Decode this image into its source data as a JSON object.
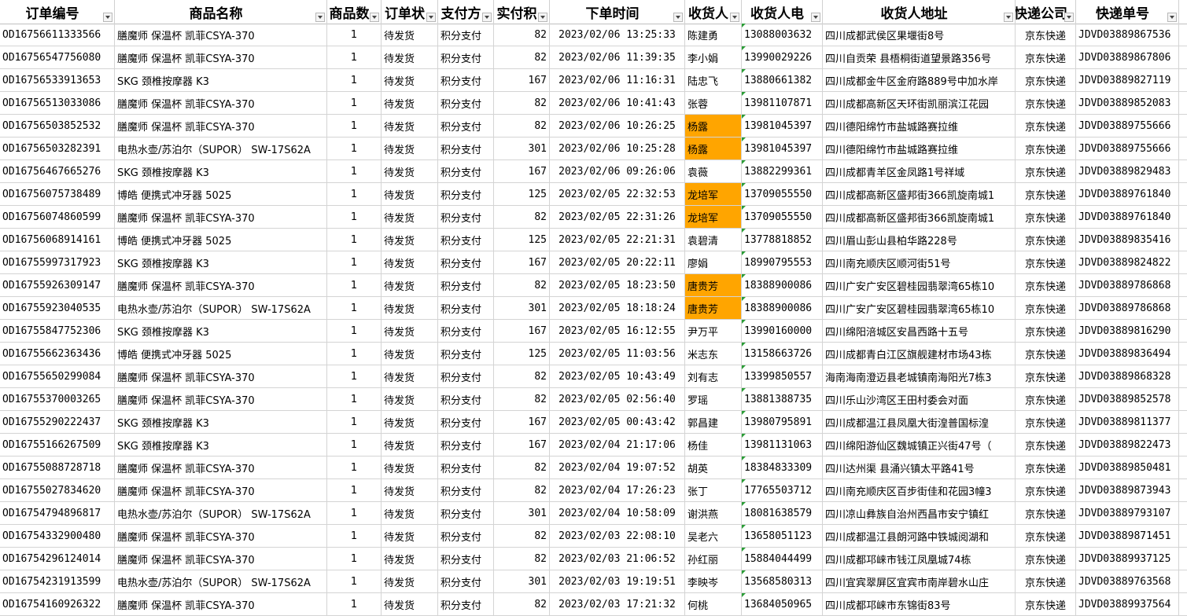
{
  "columns": [
    {
      "key": "id",
      "label": "订单编号"
    },
    {
      "key": "product",
      "label": "商品名称"
    },
    {
      "key": "qty",
      "label": "商品数"
    },
    {
      "key": "status",
      "label": "订单状"
    },
    {
      "key": "pay",
      "label": "支付方"
    },
    {
      "key": "paid",
      "label": "实付积"
    },
    {
      "key": "time",
      "label": "下单时间"
    },
    {
      "key": "name",
      "label": "收货人"
    },
    {
      "key": "phone",
      "label": "收货人电"
    },
    {
      "key": "addr",
      "label": "收货人地址"
    },
    {
      "key": "courier",
      "label": "快递公司"
    },
    {
      "key": "tracking",
      "label": "快递单号"
    }
  ],
  "highlight_color": "#ffa500",
  "rows": [
    {
      "id": "OD16756611333566",
      "product": "膳魔师 保温杯 凯菲CSYA-370",
      "qty": "1",
      "status": "待发货",
      "pay": "积分支付",
      "paid": "82",
      "time": "2023/02/06 13:25:33",
      "name": "陈建勇",
      "phone": "13088003632",
      "addr": "四川成都武侯区果堰街8号",
      "courier": "京东快递",
      "tracking": "JDVD03889867536",
      "hl": false
    },
    {
      "id": "OD16756547756080",
      "product": "膳魔师 保温杯 凯菲CSYA-370",
      "qty": "1",
      "status": "待发货",
      "pay": "积分支付",
      "paid": "82",
      "time": "2023/02/06 11:39:35",
      "name": "李小娟",
      "phone": "13990029226",
      "addr": "四川自贡荣  县梧桐街道望景路356号",
      "courier": "京东快递",
      "tracking": "JDVD03889867806",
      "hl": false
    },
    {
      "id": "OD16756533913653",
      "product": "SKG 颈椎按摩器 K3",
      "qty": "1",
      "status": "待发货",
      "pay": "积分支付",
      "paid": "167",
      "time": "2023/02/06 11:16:31",
      "name": "陆忠飞",
      "phone": "13880661382",
      "addr": "四川成都金牛区金府路889号中加水岸",
      "courier": "京东快递",
      "tracking": "JDVD03889827119",
      "hl": false
    },
    {
      "id": "OD16756513033086",
      "product": "膳魔师 保温杯 凯菲CSYA-370",
      "qty": "1",
      "status": "待发货",
      "pay": "积分支付",
      "paid": "82",
      "time": "2023/02/06 10:41:43",
      "name": "张蓉",
      "phone": "13981107871",
      "addr": "四川成都高新区天环街凯丽滨江花园",
      "courier": "京东快递",
      "tracking": "JDVD03889852083",
      "hl": false
    },
    {
      "id": "OD16756503852532",
      "product": "膳魔师 保温杯 凯菲CSYA-370",
      "qty": "1",
      "status": "待发货",
      "pay": "积分支付",
      "paid": "82",
      "time": "2023/02/06 10:26:25",
      "name": "杨露",
      "phone": "13981045397",
      "addr": "四川德阳绵竹市盐城路赛拉维",
      "courier": "京东快递",
      "tracking": "JDVD03889755666",
      "hl": true
    },
    {
      "id": "OD16756503282391",
      "product": "电热水壶/苏泊尔（SUPOR） SW-17S62A",
      "qty": "1",
      "status": "待发货",
      "pay": "积分支付",
      "paid": "301",
      "time": "2023/02/06 10:25:28",
      "name": "杨露",
      "phone": "13981045397",
      "addr": "四川德阳绵竹市盐城路赛拉维",
      "courier": "京东快递",
      "tracking": "JDVD03889755666",
      "hl": true
    },
    {
      "id": "OD16756467665276",
      "product": "SKG 颈椎按摩器 K3",
      "qty": "1",
      "status": "待发货",
      "pay": "积分支付",
      "paid": "167",
      "time": "2023/02/06 09:26:06",
      "name": "袁薇",
      "phone": "13882299361",
      "addr": "四川成都青羊区金凤路1号祥域",
      "courier": "京东快递",
      "tracking": "JDVD03889829483",
      "hl": false
    },
    {
      "id": "OD16756075738489",
      "product": "博皓 便携式冲牙器 5025",
      "qty": "1",
      "status": "待发货",
      "pay": "积分支付",
      "paid": "125",
      "time": "2023/02/05 22:32:53",
      "name": "龙培军",
      "phone": "13709055550",
      "addr": "四川成都高新区盛邦街366凯旋南城1",
      "courier": "京东快递",
      "tracking": "JDVD03889761840",
      "hl": true
    },
    {
      "id": "OD16756074860599",
      "product": "膳魔师 保温杯 凯菲CSYA-370",
      "qty": "1",
      "status": "待发货",
      "pay": "积分支付",
      "paid": "82",
      "time": "2023/02/05 22:31:26",
      "name": "龙培军",
      "phone": "13709055550",
      "addr": "四川成都高新区盛邦街366凯旋南城1",
      "courier": "京东快递",
      "tracking": "JDVD03889761840",
      "hl": true
    },
    {
      "id": "OD16756068914161",
      "product": "博皓 便携式冲牙器 5025",
      "qty": "1",
      "status": "待发货",
      "pay": "积分支付",
      "paid": "125",
      "time": "2023/02/05 22:21:31",
      "name": "袁碧清",
      "phone": "13778818852",
      "addr": "四川眉山彭山县柏华路228号",
      "courier": "京东快递",
      "tracking": "JDVD03889835416",
      "hl": false
    },
    {
      "id": "OD16755997317923",
      "product": "SKG 颈椎按摩器 K3",
      "qty": "1",
      "status": "待发货",
      "pay": "积分支付",
      "paid": "167",
      "time": "2023/02/05 20:22:11",
      "name": "廖娟",
      "phone": "18990795553",
      "addr": "四川南充顺庆区顺河街51号",
      "courier": "京东快递",
      "tracking": "JDVD03889824822",
      "hl": false
    },
    {
      "id": "OD16755926309147",
      "product": "膳魔师 保温杯 凯菲CSYA-370",
      "qty": "1",
      "status": "待发货",
      "pay": "积分支付",
      "paid": "82",
      "time": "2023/02/05 18:23:50",
      "name": "唐贵芳",
      "phone": "18388900086",
      "addr": "四川广安广安区碧桂园翡翠湾65栋10",
      "courier": "京东快递",
      "tracking": "JDVD03889786868",
      "hl": true
    },
    {
      "id": "OD16755923040535",
      "product": "电热水壶/苏泊尔（SUPOR） SW-17S62A",
      "qty": "1",
      "status": "待发货",
      "pay": "积分支付",
      "paid": "301",
      "time": "2023/02/05 18:18:24",
      "name": "唐贵芳",
      "phone": "18388900086",
      "addr": "四川广安广安区碧桂园翡翠湾65栋10",
      "courier": "京东快递",
      "tracking": "JDVD03889786868",
      "hl": true
    },
    {
      "id": "OD16755847752306",
      "product": "SKG 颈椎按摩器 K3",
      "qty": "1",
      "status": "待发货",
      "pay": "积分支付",
      "paid": "167",
      "time": "2023/02/05 16:12:55",
      "name": "尹万平",
      "phone": "13990160000",
      "addr": "四川绵阳涪城区安昌西路十五号",
      "courier": "京东快递",
      "tracking": "JDVD03889816290",
      "hl": false
    },
    {
      "id": "OD16755662363436",
      "product": "博皓 便携式冲牙器 5025",
      "qty": "1",
      "status": "待发货",
      "pay": "积分支付",
      "paid": "125",
      "time": "2023/02/05 11:03:56",
      "name": "米志东",
      "phone": "13158663726",
      "addr": "四川成都青白江区旗舰建材市场43栋",
      "courier": "京东快递",
      "tracking": "JDVD03889836494",
      "hl": false
    },
    {
      "id": "OD16755650299084",
      "product": "膳魔师 保温杯 凯菲CSYA-370",
      "qty": "1",
      "status": "待发货",
      "pay": "积分支付",
      "paid": "82",
      "time": "2023/02/05 10:43:49",
      "name": "刘有志",
      "phone": "13399850557",
      "addr": "海南海南澄迈县老城镇南海阳光7栋3",
      "courier": "京东快递",
      "tracking": "JDVD03889868328",
      "hl": false
    },
    {
      "id": "OD16755370003265",
      "product": "膳魔师 保温杯 凯菲CSYA-370",
      "qty": "1",
      "status": "待发货",
      "pay": "积分支付",
      "paid": "82",
      "time": "2023/02/05 02:56:40",
      "name": "罗瑶",
      "phone": "13881388735",
      "addr": "四川乐山沙湾区王田村委会对面",
      "courier": "京东快递",
      "tracking": "JDVD03889852578",
      "hl": false
    },
    {
      "id": "OD16755290222437",
      "product": "SKG 颈椎按摩器 K3",
      "qty": "1",
      "status": "待发货",
      "pay": "积分支付",
      "paid": "167",
      "time": "2023/02/05 00:43:42",
      "name": "郭昌建",
      "phone": "13980795891",
      "addr": "四川成都温江县凤凰大街湟普国标湟",
      "courier": "京东快递",
      "tracking": "JDVD03889811377",
      "hl": false
    },
    {
      "id": "OD16755166267509",
      "product": "SKG 颈椎按摩器 K3",
      "qty": "1",
      "status": "待发货",
      "pay": "积分支付",
      "paid": "167",
      "time": "2023/02/04 21:17:06",
      "name": "杨佳",
      "phone": "13981131063",
      "addr": "四川绵阳游仙区魏城镇正兴街47号（",
      "courier": "京东快递",
      "tracking": "JDVD03889822473",
      "hl": false
    },
    {
      "id": "OD16755088728718",
      "product": "膳魔师 保温杯 凯菲CSYA-370",
      "qty": "1",
      "status": "待发货",
      "pay": "积分支付",
      "paid": "82",
      "time": "2023/02/04 19:07:52",
      "name": "胡英",
      "phone": "18384833309",
      "addr": "四川达州渠  县涌兴镇太平路41号",
      "courier": "京东快递",
      "tracking": "JDVD03889850481",
      "hl": false
    },
    {
      "id": "OD16755027834620",
      "product": "膳魔师 保温杯 凯菲CSYA-370",
      "qty": "1",
      "status": "待发货",
      "pay": "积分支付",
      "paid": "82",
      "time": "2023/02/04 17:26:23",
      "name": "张丁",
      "phone": "17765503712",
      "addr": "四川南充顺庆区百步街佳和花园3幢3",
      "courier": "京东快递",
      "tracking": "JDVD03889873943",
      "hl": false
    },
    {
      "id": "OD16754794896817",
      "product": "电热水壶/苏泊尔（SUPOR） SW-17S62A",
      "qty": "1",
      "status": "待发货",
      "pay": "积分支付",
      "paid": "301",
      "time": "2023/02/04 10:58:09",
      "name": "谢洪燕",
      "phone": "18081638579",
      "addr": "四川凉山彝族自治州西昌市安宁镇红",
      "courier": "京东快递",
      "tracking": "JDVD03889793107",
      "hl": false
    },
    {
      "id": "OD16754332900480",
      "product": "膳魔师 保温杯 凯菲CSYA-370",
      "qty": "1",
      "status": "待发货",
      "pay": "积分支付",
      "paid": "82",
      "time": "2023/02/03 22:08:10",
      "name": "吴老六",
      "phone": "13658051123",
      "addr": "四川成都温江县朗河路中铁城阅湖和",
      "courier": "京东快递",
      "tracking": "JDVD03889871451",
      "hl": false
    },
    {
      "id": "OD16754296124014",
      "product": "膳魔师 保温杯 凯菲CSYA-370",
      "qty": "1",
      "status": "待发货",
      "pay": "积分支付",
      "paid": "82",
      "time": "2023/02/03 21:06:52",
      "name": "孙红丽",
      "phone": "15884044499",
      "addr": "四川成都邛崃市钱江凤凰城74栋",
      "courier": "京东快递",
      "tracking": "JDVD03889937125",
      "hl": false
    },
    {
      "id": "OD16754231913599",
      "product": "电热水壶/苏泊尔（SUPOR） SW-17S62A",
      "qty": "1",
      "status": "待发货",
      "pay": "积分支付",
      "paid": "301",
      "time": "2023/02/03 19:19:51",
      "name": "李映岑",
      "phone": "13568580313",
      "addr": "四川宜宾翠屏区宜宾市南岸碧水山庄",
      "courier": "京东快递",
      "tracking": "JDVD03889763568",
      "hl": false
    },
    {
      "id": "OD16754160926322",
      "product": "膳魔师 保温杯 凯菲CSYA-370",
      "qty": "1",
      "status": "待发货",
      "pay": "积分支付",
      "paid": "82",
      "time": "2023/02/03 17:21:32",
      "name": "何桃",
      "phone": "13684050965",
      "addr": "四川成都邛崃市东锦街83号",
      "courier": "京东快递",
      "tracking": "JDVD03889937564",
      "hl": false
    }
  ]
}
